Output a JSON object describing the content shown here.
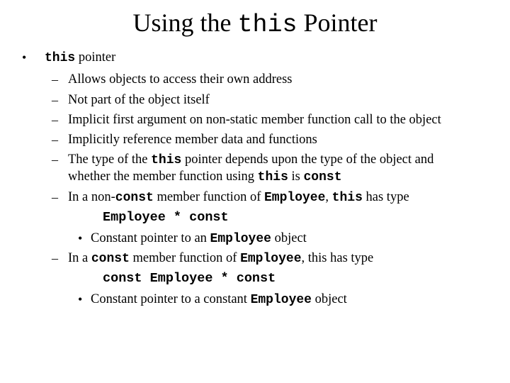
{
  "slide": {
    "title": {
      "prefix": "Using the ",
      "code": "this",
      "suffix": " Pointer"
    },
    "markers": {
      "level1": "•",
      "level2": "–",
      "level3": "•"
    },
    "bullet1": {
      "code": "this",
      "text": " pointer"
    },
    "sub_items": [
      {
        "text": "Allows objects to access their own address"
      },
      {
        "text": "Not part of the object itself"
      },
      {
        "text": "Implicit first argument on non-static member function call to the object"
      },
      {
        "text": "Implicitly reference member data and functions"
      },
      {
        "part1": "The type of the ",
        "code1": "this",
        "part2": " pointer depends upon the type of the object and",
        "part3": "whether the member function using ",
        "code2": "this",
        "part4": " is ",
        "code3": "const"
      }
    ],
    "non_const_case": {
      "part1": "In a non-",
      "code1": "const",
      "part2": " member function of ",
      "code2": "Employee",
      "part3": ", ",
      "code3": "this",
      "part4": " has type",
      "type_code": "Employee * const",
      "note_part1": "Constant pointer to an ",
      "note_code": "Employee",
      "note_part2": " object"
    },
    "const_case": {
      "part1": "In a ",
      "code1": "const",
      "part2": " member function of ",
      "code2": "Employee",
      "part3": ", this has type",
      "type_code": "const Employee * const",
      "note_part1": "Constant pointer to a constant ",
      "note_code": "Employee",
      "note_part2": " object"
    }
  }
}
